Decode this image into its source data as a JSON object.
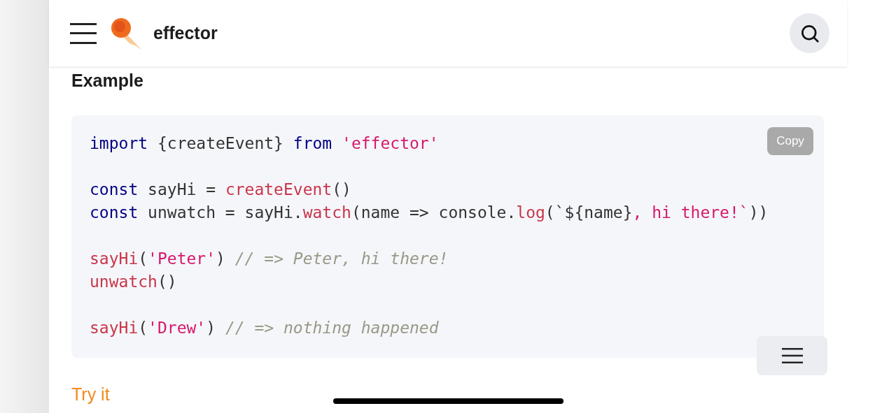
{
  "header": {
    "brand": "effector"
  },
  "section": {
    "title": "Example"
  },
  "code": {
    "copy_label": "Copy",
    "lines": [
      {
        "kind": "code",
        "tokens": [
          {
            "text": "import",
            "kind": "keyword"
          },
          {
            "text": " {createEvent} ",
            "kind": "plain"
          },
          {
            "text": "from ",
            "kind": "keyword"
          },
          {
            "text": "'effector'",
            "kind": "string"
          }
        ]
      },
      {
        "kind": "blank"
      },
      {
        "kind": "code",
        "tokens": [
          {
            "text": "const",
            "kind": "keyword"
          },
          {
            "text": " sayHi = ",
            "kind": "plain"
          },
          {
            "text": "createEvent",
            "kind": "function"
          },
          {
            "text": "()",
            "kind": "plain"
          }
        ]
      },
      {
        "kind": "code",
        "tokens": [
          {
            "text": "const",
            "kind": "keyword"
          },
          {
            "text": " unwatch = sayHi.",
            "kind": "plain"
          },
          {
            "text": "watch",
            "kind": "function"
          },
          {
            "text": "(name => console.",
            "kind": "plain"
          },
          {
            "text": "log",
            "kind": "function"
          },
          {
            "text": "(`${name}",
            "kind": "plain"
          },
          {
            "text": ", hi there!`",
            "kind": "string"
          },
          {
            "text": "))",
            "kind": "plain"
          }
        ]
      },
      {
        "kind": "blank"
      },
      {
        "kind": "code",
        "tokens": [
          {
            "text": "sayHi",
            "kind": "function"
          },
          {
            "text": "(",
            "kind": "plain"
          },
          {
            "text": "'Peter'",
            "kind": "string"
          },
          {
            "text": ") ",
            "kind": "plain"
          },
          {
            "text": "// => Peter, hi there!",
            "kind": "comment"
          }
        ]
      },
      {
        "kind": "code",
        "tokens": [
          {
            "text": "unwatch",
            "kind": "function"
          },
          {
            "text": "()",
            "kind": "plain"
          }
        ]
      },
      {
        "kind": "blank"
      },
      {
        "kind": "code",
        "tokens": [
          {
            "text": "sayHi",
            "kind": "function"
          },
          {
            "text": "(",
            "kind": "plain"
          },
          {
            "text": "'Drew'",
            "kind": "string"
          },
          {
            "text": ") ",
            "kind": "plain"
          },
          {
            "text": "// => nothing happened",
            "kind": "comment"
          }
        ]
      }
    ]
  },
  "link": {
    "label": "Try it"
  }
}
